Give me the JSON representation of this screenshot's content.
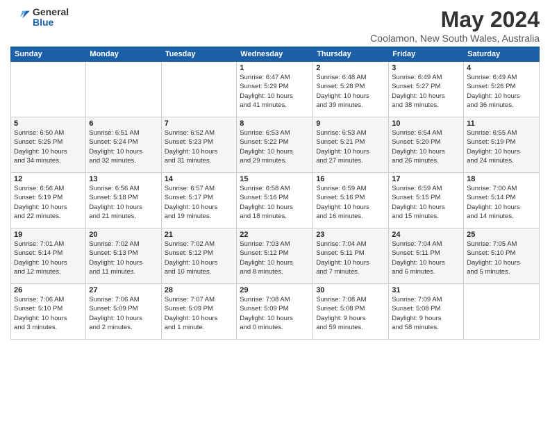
{
  "logo": {
    "general": "General",
    "blue": "Blue"
  },
  "title": "May 2024",
  "subtitle": "Coolamon, New South Wales, Australia",
  "days_header": [
    "Sunday",
    "Monday",
    "Tuesday",
    "Wednesday",
    "Thursday",
    "Friday",
    "Saturday"
  ],
  "weeks": [
    [
      {
        "num": "",
        "info": ""
      },
      {
        "num": "",
        "info": ""
      },
      {
        "num": "",
        "info": ""
      },
      {
        "num": "1",
        "info": "Sunrise: 6:47 AM\nSunset: 5:29 PM\nDaylight: 10 hours\nand 41 minutes."
      },
      {
        "num": "2",
        "info": "Sunrise: 6:48 AM\nSunset: 5:28 PM\nDaylight: 10 hours\nand 39 minutes."
      },
      {
        "num": "3",
        "info": "Sunrise: 6:49 AM\nSunset: 5:27 PM\nDaylight: 10 hours\nand 38 minutes."
      },
      {
        "num": "4",
        "info": "Sunrise: 6:49 AM\nSunset: 5:26 PM\nDaylight: 10 hours\nand 36 minutes."
      }
    ],
    [
      {
        "num": "5",
        "info": "Sunrise: 6:50 AM\nSunset: 5:25 PM\nDaylight: 10 hours\nand 34 minutes."
      },
      {
        "num": "6",
        "info": "Sunrise: 6:51 AM\nSunset: 5:24 PM\nDaylight: 10 hours\nand 32 minutes."
      },
      {
        "num": "7",
        "info": "Sunrise: 6:52 AM\nSunset: 5:23 PM\nDaylight: 10 hours\nand 31 minutes."
      },
      {
        "num": "8",
        "info": "Sunrise: 6:53 AM\nSunset: 5:22 PM\nDaylight: 10 hours\nand 29 minutes."
      },
      {
        "num": "9",
        "info": "Sunrise: 6:53 AM\nSunset: 5:21 PM\nDaylight: 10 hours\nand 27 minutes."
      },
      {
        "num": "10",
        "info": "Sunrise: 6:54 AM\nSunset: 5:20 PM\nDaylight: 10 hours\nand 26 minutes."
      },
      {
        "num": "11",
        "info": "Sunrise: 6:55 AM\nSunset: 5:19 PM\nDaylight: 10 hours\nand 24 minutes."
      }
    ],
    [
      {
        "num": "12",
        "info": "Sunrise: 6:56 AM\nSunset: 5:19 PM\nDaylight: 10 hours\nand 22 minutes."
      },
      {
        "num": "13",
        "info": "Sunrise: 6:56 AM\nSunset: 5:18 PM\nDaylight: 10 hours\nand 21 minutes."
      },
      {
        "num": "14",
        "info": "Sunrise: 6:57 AM\nSunset: 5:17 PM\nDaylight: 10 hours\nand 19 minutes."
      },
      {
        "num": "15",
        "info": "Sunrise: 6:58 AM\nSunset: 5:16 PM\nDaylight: 10 hours\nand 18 minutes."
      },
      {
        "num": "16",
        "info": "Sunrise: 6:59 AM\nSunset: 5:16 PM\nDaylight: 10 hours\nand 16 minutes."
      },
      {
        "num": "17",
        "info": "Sunrise: 6:59 AM\nSunset: 5:15 PM\nDaylight: 10 hours\nand 15 minutes."
      },
      {
        "num": "18",
        "info": "Sunrise: 7:00 AM\nSunset: 5:14 PM\nDaylight: 10 hours\nand 14 minutes."
      }
    ],
    [
      {
        "num": "19",
        "info": "Sunrise: 7:01 AM\nSunset: 5:14 PM\nDaylight: 10 hours\nand 12 minutes."
      },
      {
        "num": "20",
        "info": "Sunrise: 7:02 AM\nSunset: 5:13 PM\nDaylight: 10 hours\nand 11 minutes."
      },
      {
        "num": "21",
        "info": "Sunrise: 7:02 AM\nSunset: 5:12 PM\nDaylight: 10 hours\nand 10 minutes."
      },
      {
        "num": "22",
        "info": "Sunrise: 7:03 AM\nSunset: 5:12 PM\nDaylight: 10 hours\nand 8 minutes."
      },
      {
        "num": "23",
        "info": "Sunrise: 7:04 AM\nSunset: 5:11 PM\nDaylight: 10 hours\nand 7 minutes."
      },
      {
        "num": "24",
        "info": "Sunrise: 7:04 AM\nSunset: 5:11 PM\nDaylight: 10 hours\nand 6 minutes."
      },
      {
        "num": "25",
        "info": "Sunrise: 7:05 AM\nSunset: 5:10 PM\nDaylight: 10 hours\nand 5 minutes."
      }
    ],
    [
      {
        "num": "26",
        "info": "Sunrise: 7:06 AM\nSunset: 5:10 PM\nDaylight: 10 hours\nand 3 minutes."
      },
      {
        "num": "27",
        "info": "Sunrise: 7:06 AM\nSunset: 5:09 PM\nDaylight: 10 hours\nand 2 minutes."
      },
      {
        "num": "28",
        "info": "Sunrise: 7:07 AM\nSunset: 5:09 PM\nDaylight: 10 hours\nand 1 minute."
      },
      {
        "num": "29",
        "info": "Sunrise: 7:08 AM\nSunset: 5:09 PM\nDaylight: 10 hours\nand 0 minutes."
      },
      {
        "num": "30",
        "info": "Sunrise: 7:08 AM\nSunset: 5:08 PM\nDaylight: 9 hours\nand 59 minutes."
      },
      {
        "num": "31",
        "info": "Sunrise: 7:09 AM\nSunset: 5:08 PM\nDaylight: 9 hours\nand 58 minutes."
      },
      {
        "num": "",
        "info": ""
      }
    ]
  ]
}
